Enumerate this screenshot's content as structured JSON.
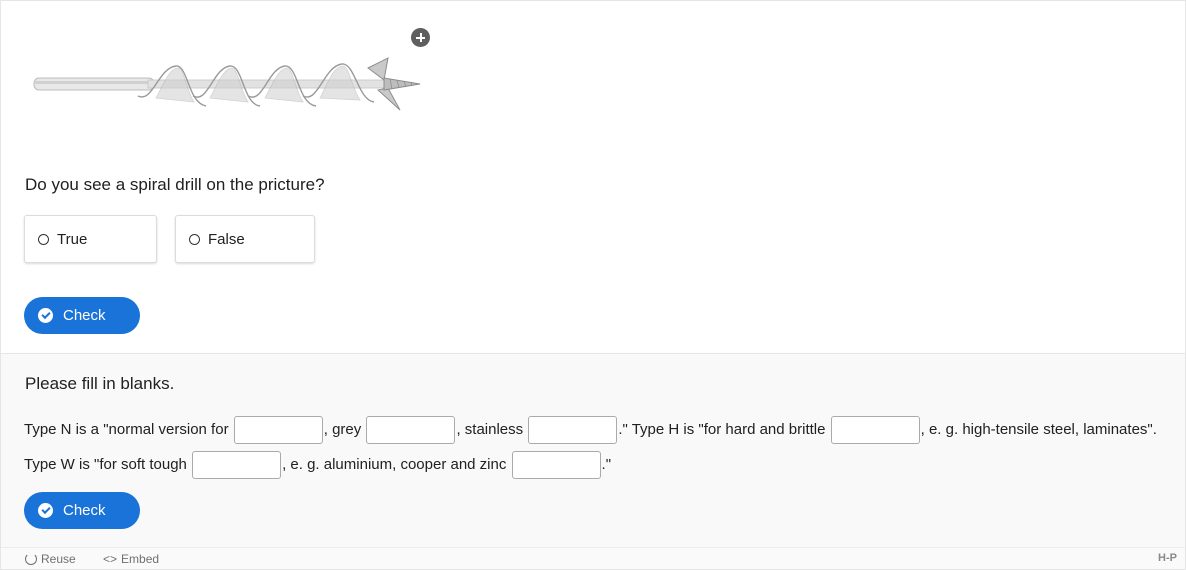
{
  "question1": {
    "image_alt": "spiral drill",
    "text": "Do you see a spiral drill on the pricture?",
    "answers": [
      {
        "label": "True"
      },
      {
        "label": "False"
      }
    ],
    "check_label": "Check"
  },
  "question2": {
    "intro": "Please fill in blanks.",
    "segments": [
      "Type N is a \"normal version for",
      ", grey",
      ", stainless",
      ".\" Type H is \"for hard and brittle",
      ", e. g. high-tensile steel, laminates\". Type W is \"for soft tough",
      ", e. g. aluminium, cooper and zinc",
      ".\""
    ],
    "blanks": [
      "",
      "",
      "",
      "",
      "",
      ""
    ],
    "check_label": "Check"
  },
  "footer": {
    "reuse_label": "Reuse",
    "embed_label": "Embed",
    "embed_glyph": "<>",
    "logo_text": "H-P"
  },
  "colors": {
    "accent": "#1a73d9"
  }
}
